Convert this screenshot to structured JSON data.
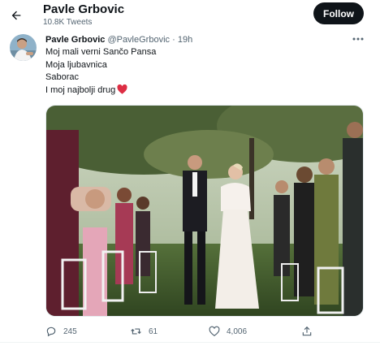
{
  "header": {
    "name": "Pavle Grbovic",
    "tweet_count": "10.8K Tweets",
    "follow_label": "Follow",
    "back_icon": "arrow-left-icon"
  },
  "tweet": {
    "author_name": "Pavle Grbovic",
    "handle": "@PavleGrbovic",
    "separator": "·",
    "time": "19h",
    "more_icon": "more-horizontal-icon",
    "lines": [
      "Moj mali verni Sančo Pansa",
      "Moja ljubavnica",
      "Saborac",
      "I moj najbolji drug"
    ],
    "emoji": "red-heart-icon",
    "stats": {
      "replies": "245",
      "retweets": "61",
      "likes": "4,006"
    }
  },
  "colors": {
    "text": "#0f1419",
    "secondary": "#536471",
    "follow_bg": "#0f1419",
    "heart": "#f91880"
  }
}
